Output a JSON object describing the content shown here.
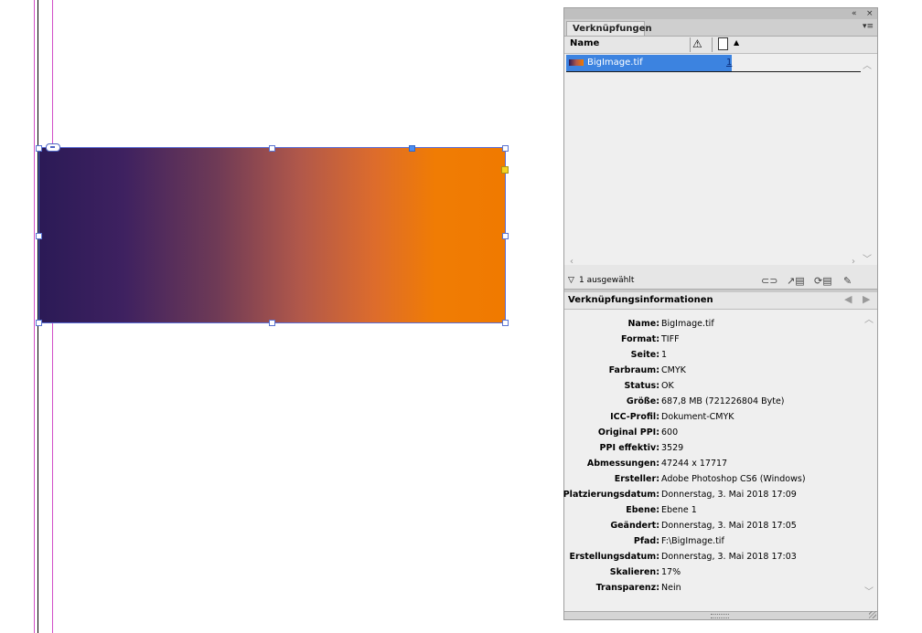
{
  "panel": {
    "topbar": {
      "collapse_icon": "«",
      "close_icon": "×"
    },
    "tab_label": "Verknüpfungen",
    "tab_menu_icon": "▾≡",
    "columns": {
      "name": "Name",
      "warning_icon": "⚠",
      "sort_icon": "▲"
    },
    "links": [
      {
        "name": "BigImage.tif",
        "page": "1"
      }
    ],
    "status_text": "1 ausgewählt",
    "tools": [
      "relink-icon",
      "goto-link-icon",
      "update-link-icon",
      "edit-original-icon"
    ]
  },
  "info": {
    "title": "Verknüpfungsinformationen",
    "rows": [
      {
        "key": "Name:",
        "value": "BigImage.tif"
      },
      {
        "key": "Format:",
        "value": "TIFF"
      },
      {
        "key": "Seite:",
        "value": "1"
      },
      {
        "key": "Farbraum:",
        "value": "CMYK"
      },
      {
        "key": "Status:",
        "value": "OK"
      },
      {
        "key": "Größe:",
        "value": "687,8 MB (721226804 Byte)"
      },
      {
        "key": "ICC-Profil:",
        "value": "Dokument-CMYK"
      },
      {
        "key": "Original PPI:",
        "value": "600"
      },
      {
        "key": "PPI effektiv:",
        "value": "3529"
      },
      {
        "key": "Abmessungen:",
        "value": "47244 x 17717"
      },
      {
        "key": "Ersteller:",
        "value": "Adobe Photoshop CS6 (Windows)"
      },
      {
        "key": "Platzierungsdatum:",
        "value": "Donnerstag, 3. Mai 2018 17:09"
      },
      {
        "key": "Ebene:",
        "value": "Ebene 1"
      },
      {
        "key": "Geändert:",
        "value": "Donnerstag, 3. Mai 2018 17:05"
      },
      {
        "key": "Pfad:",
        "value": "F:\\BigImage.tif"
      },
      {
        "key": "Erstellungsdatum:",
        "value": "Donnerstag, 3. Mai 2018 17:03"
      },
      {
        "key": "Skalieren:",
        "value": "17%"
      },
      {
        "key": "Transparenz:",
        "value": "Nein"
      }
    ]
  },
  "colors": {
    "gradient_start": "#2b1a56",
    "gradient_end": "#f07a00",
    "selection": "#3c83e0",
    "guide": "#d24fc8"
  }
}
